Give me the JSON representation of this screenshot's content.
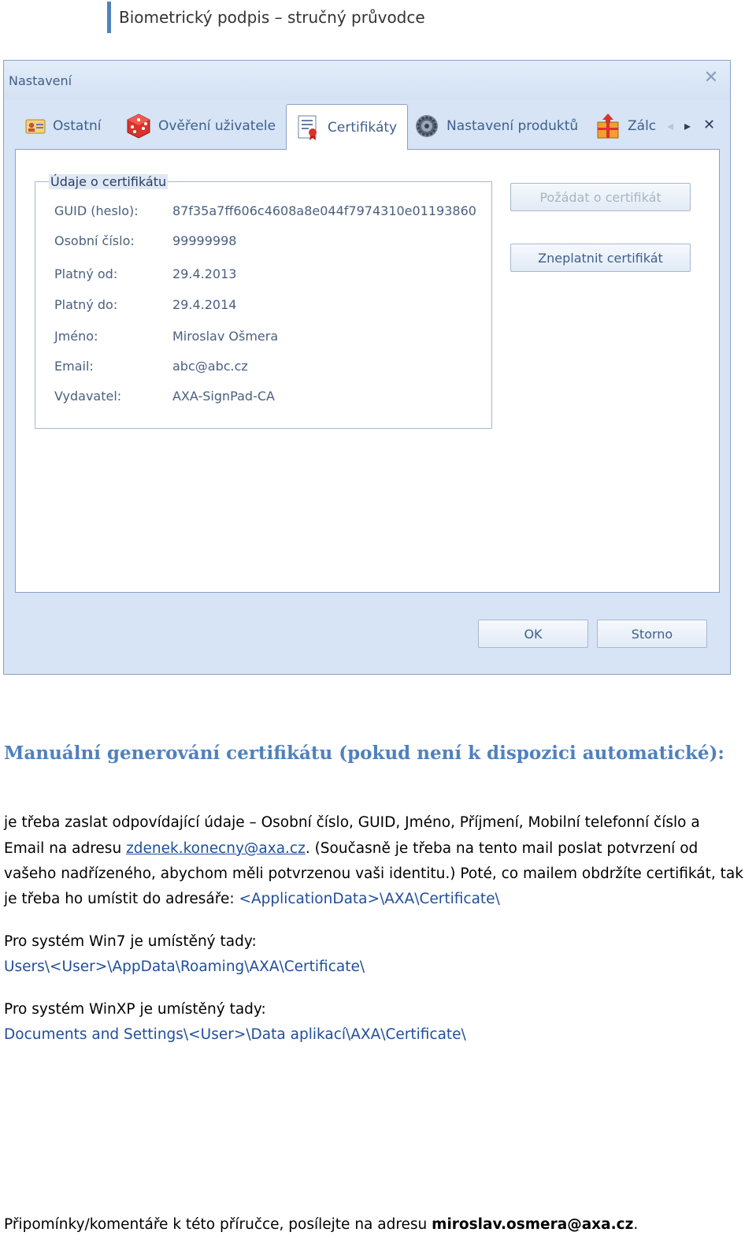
{
  "doc": {
    "header": "Biometrický podpis – stručný průvodce",
    "heading": "Manuální generování certifikátu (pokud není k dispozici automatické):",
    "para1_line1": "je třeba zaslat odpovídající údaje – Osobní číslo, GUID, Jméno, Příjmení, Mobilní telefonní číslo a",
    "para1_line2_pre": "Email na adresu ",
    "para1_link": "zdenek.konecny@axa.cz",
    "para1_line2_post": ". (Současně je třeba na tento mail poslat potvrzení od",
    "para1_line3": "vašeho nadřízeného, abychom měli potvrzenou vaši identitu.) Poté, co mailem obdržíte certifikát, tak",
    "para1_line4_pre": "je třeba ho umístit do adresáře: ",
    "para1_path": "<ApplicationData>\\AXA\\Certificate\\",
    "win7_label": "Pro systém Win7 je umístěný tady:",
    "win7_path": "Users\\<User>\\AppData\\Roaming\\AXA\\Certificate\\",
    "winxp_label": "Pro systém WinXP je umístěný tady:",
    "winxp_path": "Documents and Settings\\<User>\\Data aplikací\\AXA\\Certificate\\",
    "footer_pre": "Připomínky/komentáře k této příručce, posílejte na adresu ",
    "footer_email": "miroslav.osmera@axa.cz",
    "footer_post": "."
  },
  "dialog": {
    "title": "Nastavení",
    "close_glyph": "✕",
    "tabs": [
      {
        "label": "Ostatní",
        "icon": "contact-card-icon"
      },
      {
        "label": "Ověření uživatele",
        "icon": "dice-icon"
      },
      {
        "label": "Certifikáty",
        "icon": "certificate-icon"
      },
      {
        "label": "Nastavení produktů",
        "icon": "gear-icon"
      },
      {
        "label": "Zálc",
        "icon": "backup-box-icon"
      }
    ],
    "nav_left": "◂",
    "nav_right": "▸",
    "nav_close": "✕",
    "group_title": "Údaje o certifikátu",
    "fields": [
      {
        "label": "GUID (heslo):",
        "value": "87f35a7ff606c4608a8e044f7974310e01193860"
      },
      {
        "label": "Osobní číslo:",
        "value": "99999998"
      },
      {
        "label": "Platný od:",
        "value": "29.4.2013"
      },
      {
        "label": "Platný do:",
        "value": "29.4.2014"
      },
      {
        "label": "Jméno:",
        "value": "Miroslav Ošmera"
      },
      {
        "label": "Email:",
        "value": "abc@abc.cz"
      },
      {
        "label": "Vydavatel:",
        "value": "AXA-SignPad-CA"
      }
    ],
    "request_button": "Požádat o certifikát",
    "revoke_button": "Zneplatnit certifikát",
    "ok_button": "OK",
    "cancel_button": "Storno"
  }
}
